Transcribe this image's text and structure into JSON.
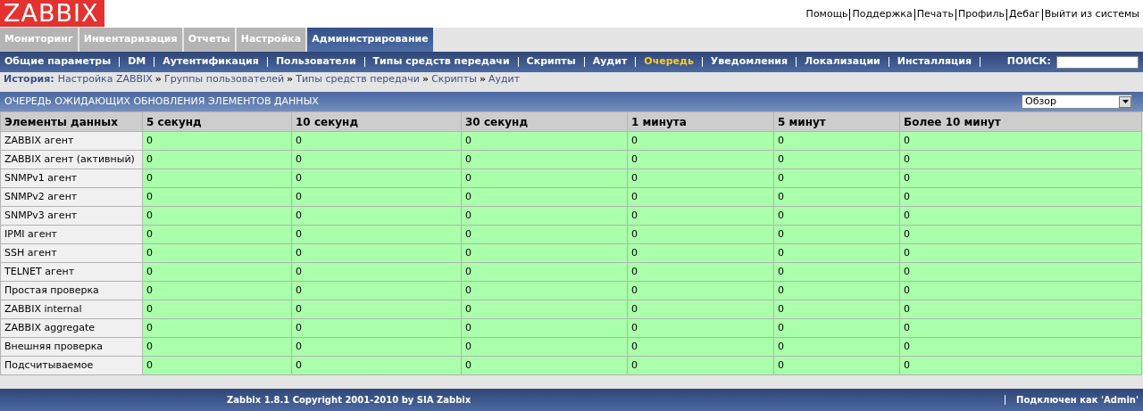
{
  "logo": "ZABBIX",
  "top_links": [
    "Помощь",
    "Поддержка",
    "Печать",
    "Профиль",
    "Дебаг",
    "Выйти из системы"
  ],
  "main_tabs": [
    {
      "label": "Мониторинг",
      "selected": false
    },
    {
      "label": "Инвентаризация",
      "selected": false
    },
    {
      "label": "Отчеты",
      "selected": false
    },
    {
      "label": "Настройка",
      "selected": false
    },
    {
      "label": "Администрирование",
      "selected": true
    }
  ],
  "sub_menu": [
    {
      "label": "Общие параметры",
      "selected": false
    },
    {
      "label": "DM",
      "selected": false
    },
    {
      "label": "Аутентификация",
      "selected": false
    },
    {
      "label": "Пользователи",
      "selected": false
    },
    {
      "label": "Типы средств передачи",
      "selected": false
    },
    {
      "label": "Скрипты",
      "selected": false
    },
    {
      "label": "Аудит",
      "selected": false
    },
    {
      "label": "Очередь",
      "selected": true
    },
    {
      "label": "Уведомления",
      "selected": false
    },
    {
      "label": "Локализации",
      "selected": false
    },
    {
      "label": "Инсталляция",
      "selected": false
    }
  ],
  "search": {
    "label": "ПОИСК:"
  },
  "history": {
    "label": "История:",
    "separator": "»",
    "items": [
      "Настройка ZABBIX",
      "Группы пользователей",
      "Типы средств передачи",
      "Скрипты",
      "Аудит"
    ]
  },
  "panel": {
    "title": "ОЧЕРЕДЬ ОЖИДАЮЩИХ ОБНОВЛЕНИЯ ЭЛЕМЕНТОВ ДАННЫХ",
    "view_select": "Обзор"
  },
  "table": {
    "columns": [
      "Элементы данных",
      "5 секунд",
      "10 секунд",
      "30 секунд",
      "1 минута",
      "5 минут",
      "Более 10 минут"
    ],
    "rows": [
      {
        "label": "ZABBIX агент",
        "values": [
          "0",
          "0",
          "0",
          "0",
          "0",
          "0"
        ]
      },
      {
        "label": "ZABBIX агент (активный)",
        "values": [
          "0",
          "0",
          "0",
          "0",
          "0",
          "0"
        ]
      },
      {
        "label": "SNMPv1 агент",
        "values": [
          "0",
          "0",
          "0",
          "0",
          "0",
          "0"
        ]
      },
      {
        "label": "SNMPv2 агент",
        "values": [
          "0",
          "0",
          "0",
          "0",
          "0",
          "0"
        ]
      },
      {
        "label": "SNMPv3 агент",
        "values": [
          "0",
          "0",
          "0",
          "0",
          "0",
          "0"
        ]
      },
      {
        "label": "IPMI агент",
        "values": [
          "0",
          "0",
          "0",
          "0",
          "0",
          "0"
        ]
      },
      {
        "label": "SSH агент",
        "values": [
          "0",
          "0",
          "0",
          "0",
          "0",
          "0"
        ]
      },
      {
        "label": "TELNET агент",
        "values": [
          "0",
          "0",
          "0",
          "0",
          "0",
          "0"
        ]
      },
      {
        "label": "Простая проверка",
        "values": [
          "0",
          "0",
          "0",
          "0",
          "0",
          "0"
        ]
      },
      {
        "label": "ZABBIX internal",
        "values": [
          "0",
          "0",
          "0",
          "0",
          "0",
          "0"
        ]
      },
      {
        "label": "ZABBIX aggregate",
        "values": [
          "0",
          "0",
          "0",
          "0",
          "0",
          "0"
        ]
      },
      {
        "label": "Внешняя проверка",
        "values": [
          "0",
          "0",
          "0",
          "0",
          "0",
          "0"
        ]
      },
      {
        "label": "Подсчитываемое",
        "values": [
          "0",
          "0",
          "0",
          "0",
          "0",
          "0"
        ]
      }
    ]
  },
  "footer": {
    "copyright": "Zabbix 1.8.1 Copyright 2001-2010 by SIA Zabbix",
    "connected": "Подключен как 'Admin'"
  }
}
